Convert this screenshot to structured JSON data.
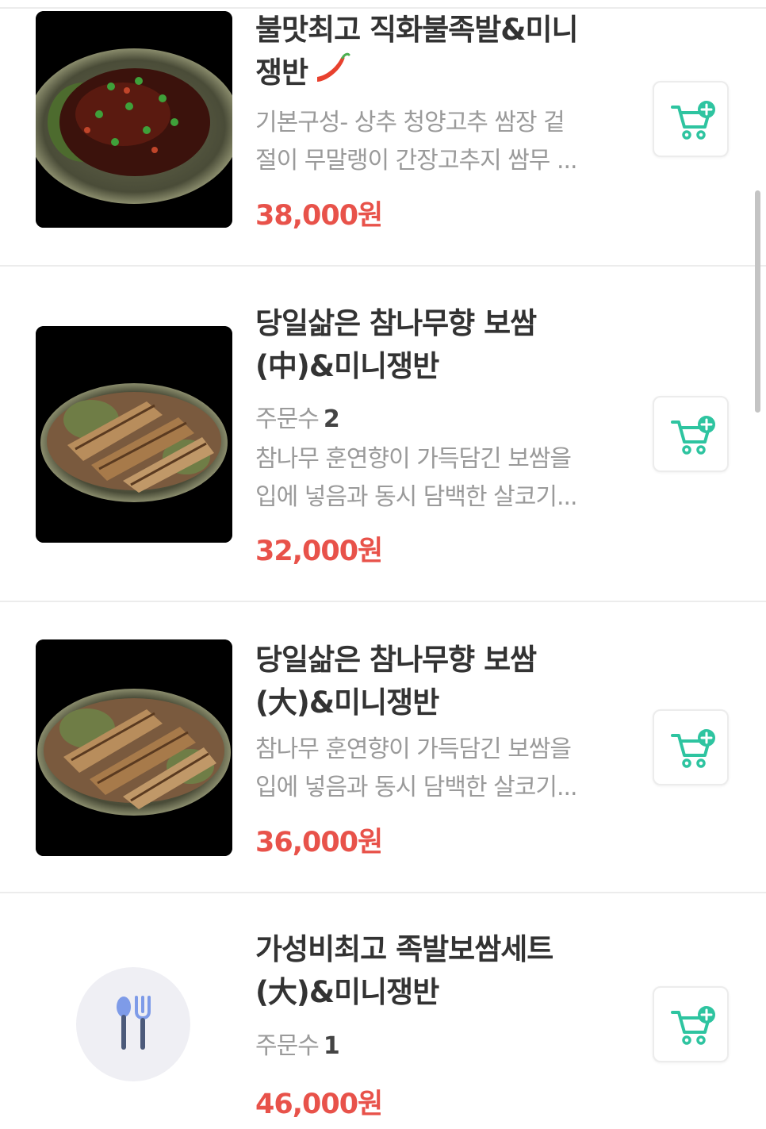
{
  "menu_items": [
    {
      "title_lines": [
        "불맛최고 직화불족발&미니",
        "쟁반"
      ],
      "spicy": true,
      "description_lines": [
        "기본구성- 상추 청양고추 쌈장 겉",
        "절이 무말랭이 간장고추지 쌈무 ..."
      ],
      "price": "38,000원",
      "image": "jokbal-spicy-photo"
    },
    {
      "title_lines": [
        "당일삶은 참나무향 보쌈",
        "(中)&미니쟁반"
      ],
      "orders_label": "주문수",
      "orders_count": "2",
      "description_lines": [
        "참나무 훈연향이 가득담긴 보쌈을",
        "입에 넣음과 동시 담백한 살코기..."
      ],
      "price": "32,000원",
      "image": "bossam-photo"
    },
    {
      "title_lines": [
        "당일삶은 참나무향 보쌈",
        "(大)&미니쟁반"
      ],
      "description_lines": [
        "참나무 훈연향이 가득담긴 보쌈을",
        "입에 넣음과 동시 담백한 살코기..."
      ],
      "price": "36,000원",
      "image": "bossam-photo"
    },
    {
      "title_lines": [
        "가성비최고 족발보쌈세트",
        "(大)&미니쟁반"
      ],
      "orders_label": "주문수",
      "orders_count": "1",
      "price": "46,000원",
      "image": "utensils-placeholder"
    }
  ],
  "icons": {
    "cart_add": "cart-add-icon",
    "spicy": "chili-pepper-icon",
    "placeholder": "fork-spoon-icon"
  },
  "colors": {
    "price": "#e8524a",
    "cart_icon": "#2ec4a0",
    "title": "#333333",
    "description": "#9a9a9a"
  }
}
